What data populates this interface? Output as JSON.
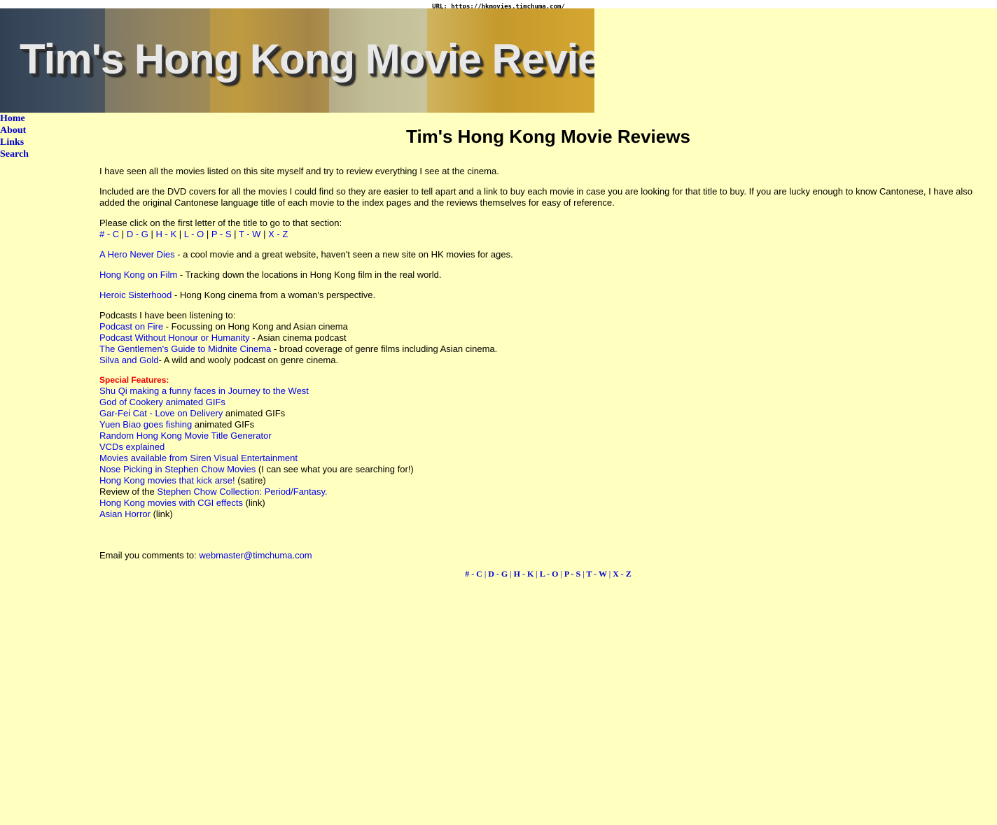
{
  "url_bar": {
    "text": "URL: https://hkmovies.timchuma.com/"
  },
  "banner": {
    "title": "Tim's Hong Kong Movie Reviews"
  },
  "sidebar": {
    "items": [
      {
        "label": "Home"
      },
      {
        "label": "About"
      },
      {
        "label": "Links"
      },
      {
        "label": "Search"
      }
    ]
  },
  "main": {
    "title": "Tim's Hong Kong Movie Reviews",
    "intro_1": "I have seen all the movies listed on this site myself and try to review everything I see at the cinema.",
    "intro_2": "Included are the DVD covers for all the movies I could find so they are easier to tell apart and a link to buy each movie in case you are looking for that title to buy. If you are lucky enough to know Cantonese, I have also added the original Cantonese language title of each movie to the index pages and the reviews themselves for easy of reference.",
    "click_prompt": "Please click on the first letter of the title to go to that section:",
    "letter_nav": [
      "# - C",
      "D - G",
      "H - K",
      "L - O",
      "P - S",
      "T - W",
      "X - Z"
    ],
    "nav_separator": "|",
    "sites": [
      {
        "link": "A Hero Never Dies",
        "desc": " - a cool movie and a great website, haven't seen a new site on HK movies for ages."
      },
      {
        "link": "Hong Kong on Film",
        "desc": " - Tracking down the locations in Hong Kong film in the real world."
      },
      {
        "link": "Heroic Sisterhood",
        "desc": " - Hong Kong cinema from a woman's perspective."
      }
    ],
    "podcasts_heading": "Podcasts I have been listening to:",
    "podcasts": [
      {
        "link": "Podcast on Fire",
        "desc": " - Focussing on Hong Kong and Asian cinema"
      },
      {
        "link": "Podcast Without Honour or Humanity",
        "desc": " - Asian cinema podcast"
      },
      {
        "link": "The Gentlemen's Guide to Midnite Cinema",
        "desc": " - broad coverage of genre films including Asian cinema."
      },
      {
        "link": "Silva and Gold",
        "desc": "- A wild and wooly podcast on genre cinema."
      }
    ],
    "special_heading": "Special Features:",
    "features": [
      {
        "prefix": "",
        "link": "Shu Qi making a funny faces in Journey to the West",
        "suffix": ""
      },
      {
        "prefix": "",
        "link": "God of Cookery animated GIFs",
        "suffix": ""
      },
      {
        "prefix": "",
        "link": "Gar-Fei Cat - Love on Delivery",
        "suffix": " animated GIFs"
      },
      {
        "prefix": "",
        "link": "Yuen Biao goes fishing",
        "suffix": " animated GIFs"
      },
      {
        "prefix": "",
        "link": "Random Hong Kong Movie Title Generator",
        "suffix": ""
      },
      {
        "prefix": "",
        "link": "VCDs explained",
        "suffix": ""
      },
      {
        "prefix": "",
        "link": "Movies available from Siren Visual Entertainment",
        "suffix": ""
      },
      {
        "prefix": "",
        "link": "Nose Picking in Stephen Chow Movies",
        "suffix": " (I can see what you are searching for!)"
      },
      {
        "prefix": "",
        "link": "Hong Kong movies that kick arse!",
        "suffix": " (satire)"
      },
      {
        "prefix": "Review of the ",
        "link": "Stephen Chow Collection: Period/Fantasy.",
        "suffix": ""
      },
      {
        "prefix": "",
        "link": "Hong Kong movies with CGI effects",
        "suffix": " (link)"
      },
      {
        "prefix": "",
        "link": "Asian Horror",
        "suffix": " (link)"
      }
    ],
    "email_label": "Email you comments to: ",
    "email": "webmaster@timchuma.com"
  },
  "footer_nav": [
    "# - C",
    "D - G",
    "H - K",
    "L - O",
    "P - S",
    "T - W",
    "X - Z"
  ]
}
